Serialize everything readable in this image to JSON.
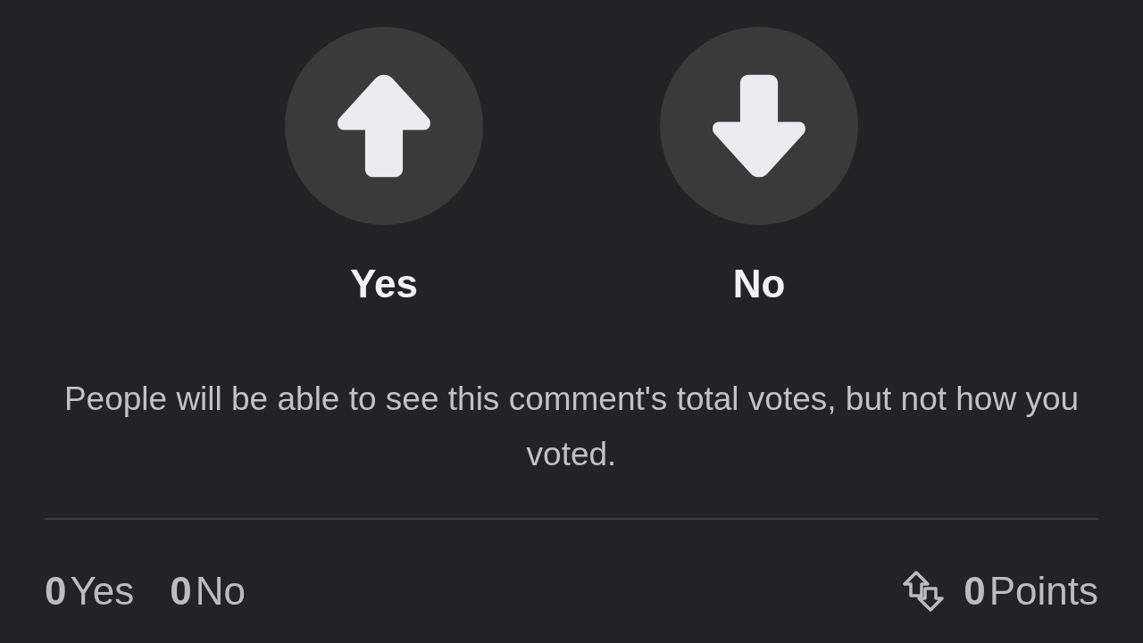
{
  "vote_options": [
    {
      "kind": "up",
      "label": "Yes"
    },
    {
      "kind": "down",
      "label": "No"
    }
  ],
  "note": "People will be able to see this comment's total votes, but not how you voted.",
  "tallies": [
    {
      "count": "0",
      "label": "Yes"
    },
    {
      "count": "0",
      "label": "No"
    }
  ],
  "points": {
    "count": "0",
    "label": "Points"
  }
}
